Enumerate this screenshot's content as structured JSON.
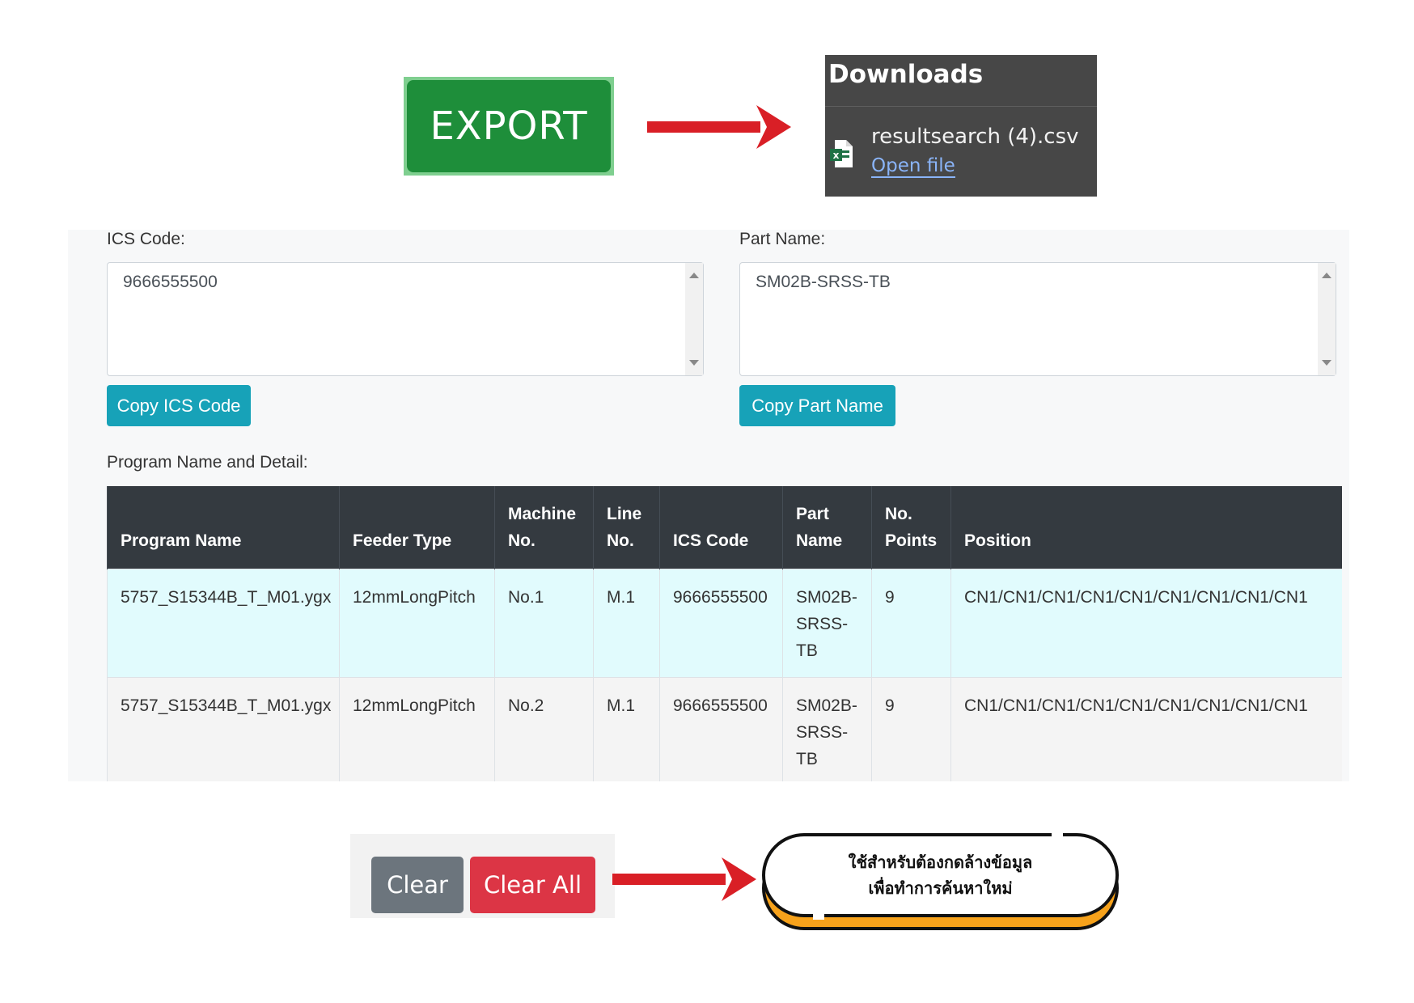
{
  "export": {
    "label": "EXPORT"
  },
  "downloads": {
    "title": "Downloads",
    "file_name": "resultsearch (4).csv",
    "open_label": "Open file"
  },
  "form": {
    "ics_label": "ICS Code:",
    "ics_value": "9666555500",
    "part_label": "Part Name:",
    "part_value": "SM02B-SRSS-TB",
    "copy_ics_label": "Copy ICS Code",
    "copy_part_label": "Copy Part Name",
    "program_label": "Program Name and Detail:"
  },
  "table": {
    "headers": [
      "Program Name",
      "Feeder Type",
      "Machine No.",
      "Line No.",
      "ICS Code",
      "Part Name",
      "No. Points",
      "Position"
    ],
    "rows": [
      [
        "5757_S15344B_T_M01.ygx",
        "12mmLongPitch",
        "No.1",
        "M.1",
        "9666555500",
        "SM02B-SRSS-TB",
        "9",
        "CN1/CN1/CN1/CN1/CN1/CN1/CN1/CN1/CN1"
      ],
      [
        "5757_S15344B_T_M01.ygx",
        "12mmLongPitch",
        "No.2",
        "M.1",
        "9666555500",
        "SM02B-SRSS-TB",
        "9",
        "CN1/CN1/CN1/CN1/CN1/CN1/CN1/CN1/CN1"
      ]
    ]
  },
  "actions": {
    "clear_label": "Clear",
    "clear_all_label": "Clear All"
  },
  "callout": {
    "line1": "ใช้สำหรับต้องกดล้างข้อมูล",
    "line2": "เพื่อทำการค้นหาใหม่"
  },
  "colors": {
    "export_green": "#1e8e3a",
    "arrow_red": "#d91f26",
    "info_teal": "#17a2b8",
    "danger_red": "#dc3545",
    "secondary_gray": "#6c757d",
    "table_header": "#343a40",
    "callout_orange": "#f7a21b"
  }
}
